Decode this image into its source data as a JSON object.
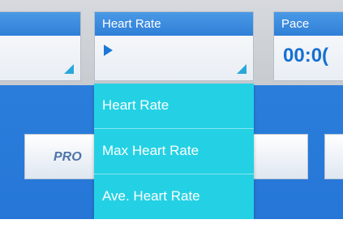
{
  "tiles": {
    "left": {
      "title": "",
      "value": ""
    },
    "heart_rate": {
      "title": "Heart Rate",
      "icon": "play-arrow-icon"
    },
    "pace": {
      "title": "Pace",
      "value": "00:0("
    }
  },
  "panel": {
    "partial_text": "PRO"
  },
  "dropdown": {
    "items": [
      {
        "label": "Heart Rate"
      },
      {
        "label": "Max Heart Rate"
      },
      {
        "label": "Ave. Heart Rate"
      }
    ]
  }
}
